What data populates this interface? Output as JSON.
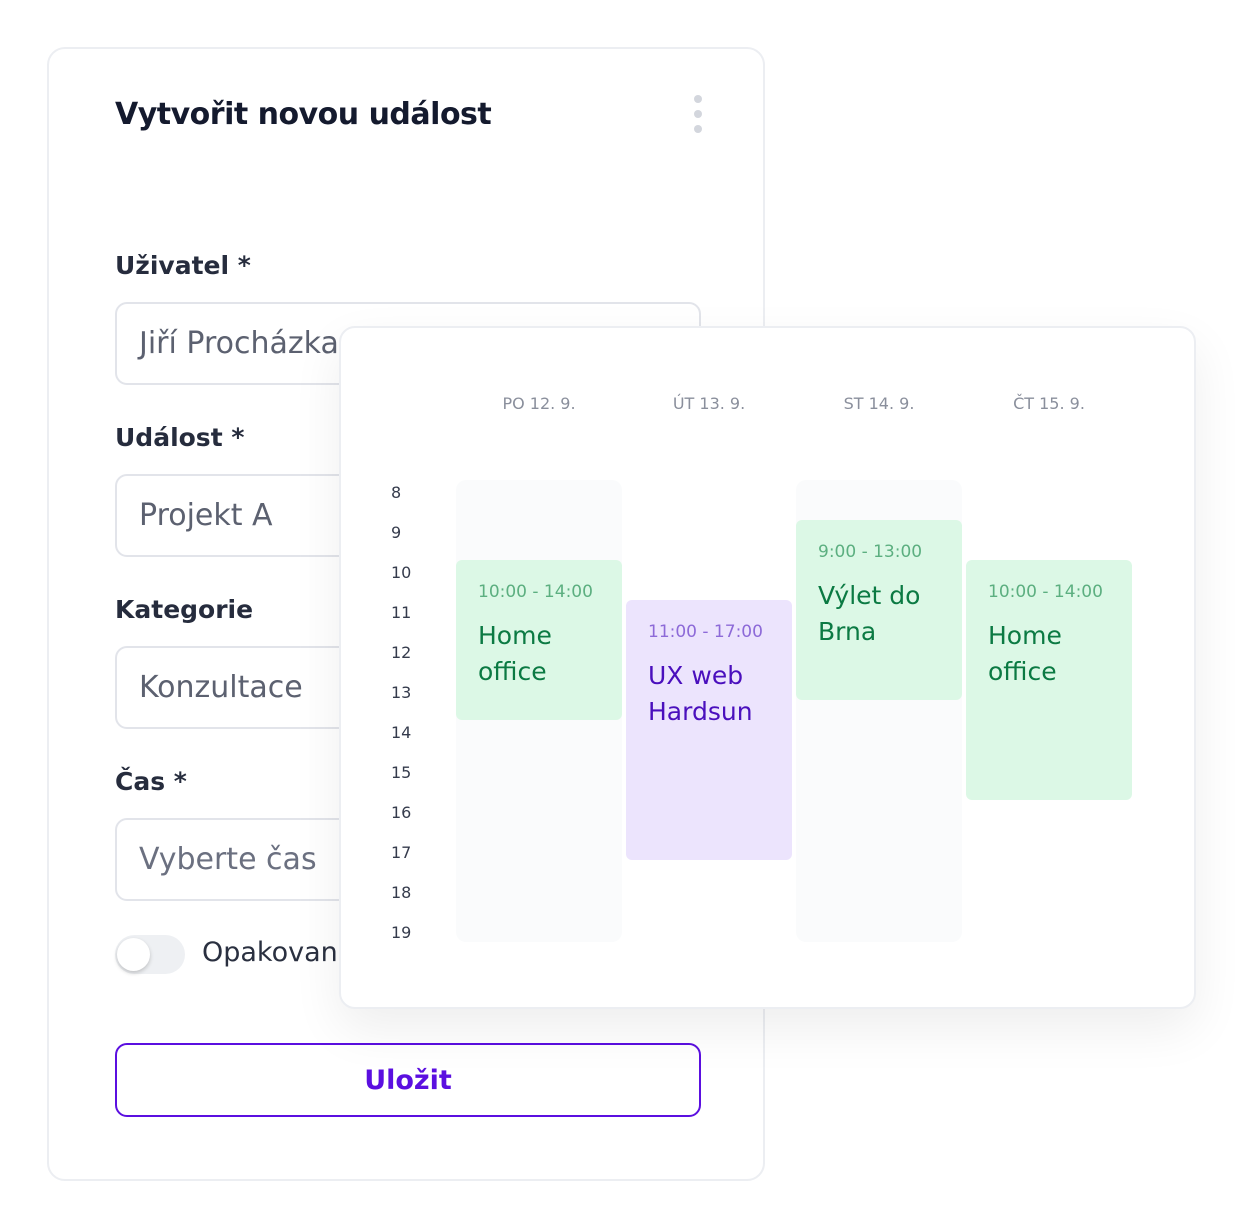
{
  "form": {
    "title": "Vytvořit novou událost",
    "fields": [
      {
        "label": "Uživatel *",
        "value": "Jiří Procházka"
      },
      {
        "label": "Událost *",
        "value": "Projekt A"
      },
      {
        "label": "Kategorie",
        "value": "Konzultace"
      },
      {
        "label": "Čas *",
        "placeholder": "Vyberte čas"
      }
    ],
    "repeat_label": "Opakovaná",
    "repeat_on": false,
    "save_label": "Uložit",
    "accent": "#5b0fe0"
  },
  "calendar": {
    "days": [
      "PO 12. 9.",
      "ÚT 13. 9.",
      "ST 14. 9.",
      "ČT 15. 9."
    ],
    "hours": [
      "8",
      "9",
      "10",
      "11",
      "12",
      "13",
      "14",
      "15",
      "16",
      "17",
      "18",
      "19"
    ],
    "events": [
      {
        "day": 0,
        "time": "10:00 - 14:00",
        "name": "Home office",
        "start": 10,
        "end": 14,
        "color": "green"
      },
      {
        "day": 1,
        "time": "11:00 - 17:00",
        "name": "UX web Hardsun",
        "start": 11,
        "end": 17.5,
        "color": "purple"
      },
      {
        "day": 2,
        "time": "9:00 - 13:00",
        "name": "Výlet do Brna",
        "start": 9,
        "end": 13.5,
        "color": "green"
      },
      {
        "day": 3,
        "time": "10:00 - 14:00",
        "name": "Home office",
        "start": 10,
        "end": 16,
        "color": "green"
      }
    ]
  }
}
